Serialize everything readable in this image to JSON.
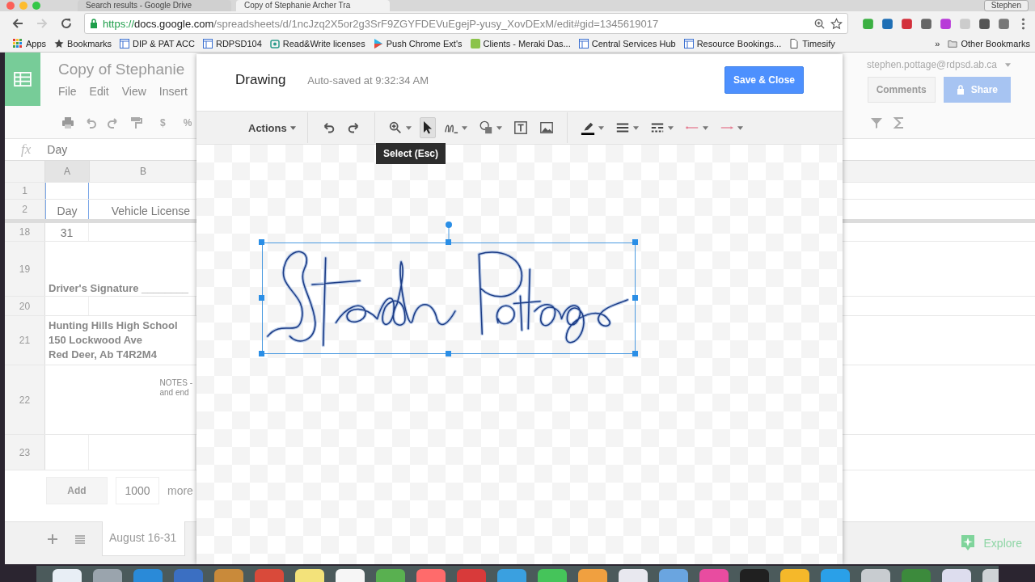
{
  "browser": {
    "tabs": [
      {
        "title": "Search results - Google Drive",
        "selected": false
      },
      {
        "title": "Copy of Stephanie Archer Tra",
        "selected": true
      }
    ],
    "profile": "Stephen",
    "url": {
      "scheme": "https://",
      "host": "docs.google.com",
      "path": "/spreadsheets/d/1ncJzq2X5or2g3SrF9ZGYFDEVuEgejP-yusy_XovDExM/edit#gid=1345619017"
    },
    "bookmarks": [
      {
        "kind": "apps",
        "label": "Apps"
      },
      {
        "kind": "star",
        "label": "Bookmarks"
      },
      {
        "kind": "page",
        "label": "DIP & PAT ACC"
      },
      {
        "kind": "page",
        "label": "RDPSD104"
      },
      {
        "kind": "readwrite",
        "label": "Read&Write licenses"
      },
      {
        "kind": "play",
        "label": "Push Chrome Ext's"
      },
      {
        "kind": "m",
        "label": "Clients - Meraki Das..."
      },
      {
        "kind": "page",
        "label": "Central Services Hub"
      },
      {
        "kind": "page",
        "label": "Resource Bookings..."
      },
      {
        "kind": "doc",
        "label": "Timesify"
      }
    ],
    "overflow": "»",
    "other_bookmarks": "Other Bookmarks"
  },
  "sheets": {
    "title": "Copy of Stephanie",
    "menus": [
      "File",
      "Edit",
      "View",
      "Insert"
    ],
    "account": "stephen.pottage@rdpsd.ab.ca",
    "comments_button": "Comments",
    "share_button": "Share",
    "toolbar_texts": [
      "$",
      "%"
    ],
    "fx": "fx",
    "formula": "Day",
    "columns": [
      {
        "label": "A",
        "selected": true
      },
      {
        "label": "B",
        "selected": false
      }
    ],
    "rows": [
      {
        "number": "1"
      },
      {
        "number": "2",
        "cells": [
          "Day",
          "Vehicle License"
        ]
      },
      {
        "number": "18",
        "cells": [
          "31"
        ]
      },
      {
        "number": "19",
        "note": "Driver's Signature ________"
      },
      {
        "number": "20"
      },
      {
        "number": "21",
        "lines": [
          "Hunting Hills High School",
          "150 Lockwood Ave",
          "Red Deer, Ab   T4R2M4"
        ]
      },
      {
        "number": "22",
        "notes": [
          "NOTES -",
          "and end"
        ]
      },
      {
        "number": "23"
      }
    ],
    "add_button": "Add",
    "add_count": "1000",
    "add_more": "more",
    "sheet_tabs": [
      {
        "label": "August 16-31",
        "selected": true
      }
    ],
    "explore": "Explore"
  },
  "drawing": {
    "title": "Drawing",
    "status": "Auto-saved at 9:32:34 AM",
    "save_button": "Save & Close",
    "actions": "Actions",
    "tools": [
      {
        "kind": "undo",
        "selected": false
      },
      {
        "kind": "redo",
        "selected": false
      },
      {
        "kind": "zoom",
        "selected": false
      },
      {
        "kind": "select",
        "selected": true
      },
      {
        "kind": "line",
        "selected": false
      },
      {
        "kind": "shape",
        "selected": false
      },
      {
        "kind": "textbox",
        "selected": false
      },
      {
        "kind": "image",
        "selected": false
      },
      {
        "kind": "pen",
        "selected": false
      },
      {
        "kind": "weight",
        "selected": false
      },
      {
        "kind": "dash",
        "selected": false
      },
      {
        "kind": "start",
        "selected": false
      },
      {
        "kind": "end",
        "selected": false
      }
    ],
    "tooltip": "Select (Esc)"
  }
}
